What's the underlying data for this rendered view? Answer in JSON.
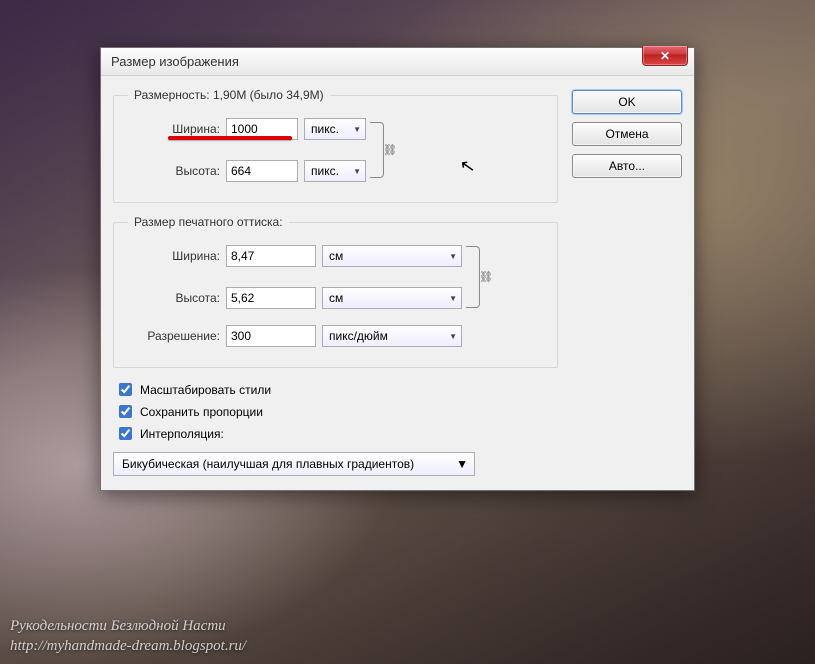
{
  "dialog": {
    "title": "Размер изображения",
    "buttons": {
      "ok": "OK",
      "cancel": "Отмена",
      "auto": "Авто..."
    }
  },
  "pixelDims": {
    "legend": "Размерность:    1,90M (было 34,9M)",
    "widthLabel": "Ширина:",
    "widthValue": "1000",
    "heightLabel": "Высота:",
    "heightValue": "664",
    "unit": "пикс."
  },
  "printDims": {
    "legend": "Размер печатного оттиска:",
    "widthLabel": "Ширина:",
    "widthValue": "8,47",
    "heightLabel": "Высота:",
    "heightValue": "5,62",
    "unit": "см",
    "resLabel": "Разрешение:",
    "resValue": "300",
    "resUnit": "пикс/дюйм"
  },
  "checks": {
    "scaleStyles": "Масштабировать стили",
    "constrain": "Сохранить пропорции",
    "resample": "Интерполяция:"
  },
  "interpolation": "Бикубическая (наилучшая для плавных градиентов)",
  "watermark": {
    "line1": "Рукодельности Безлюдной Насти",
    "line2": "http://myhandmade-dream.blogspot.ru/"
  }
}
